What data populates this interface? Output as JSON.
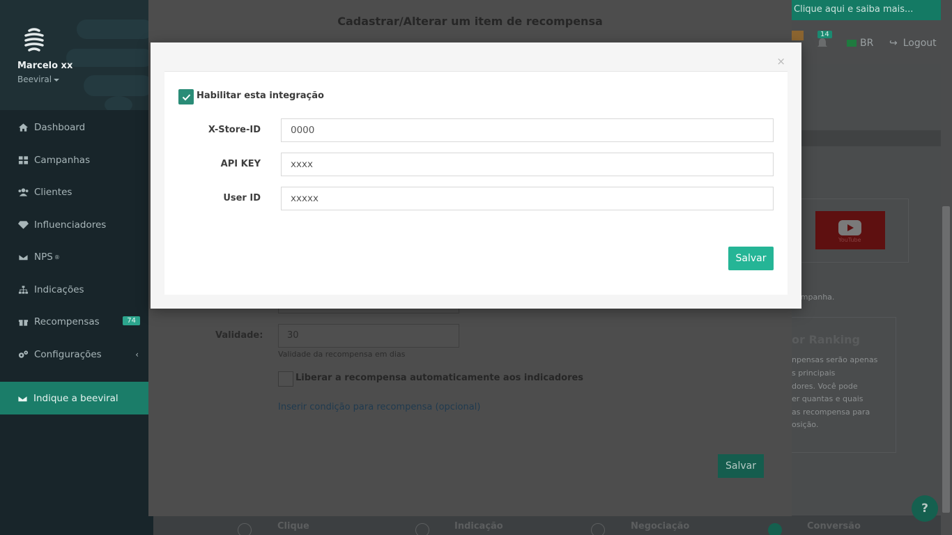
{
  "sidebar": {
    "user_name": "Marcelo xx",
    "org_name": "Beeviral",
    "items": [
      {
        "label": "Dashboard",
        "icon": "home-icon"
      },
      {
        "label": "Campanhas",
        "icon": "grid-icon"
      },
      {
        "label": "Clientes",
        "icon": "users-icon"
      },
      {
        "label": "Influenciadores",
        "icon": "diamond-icon"
      },
      {
        "label": "NPS",
        "icon": "envelope-icon",
        "sup": "®"
      },
      {
        "label": "Indicações",
        "icon": "sitemap-icon"
      },
      {
        "label": "Recompensas",
        "icon": "gift-icon",
        "badge": "74"
      },
      {
        "label": "Configurações",
        "icon": "gears-icon",
        "chevron": "‹"
      }
    ],
    "cta_label": "Indique a beeviral"
  },
  "topbar": {
    "banner_text": "Clique aqui e saiba mais...",
    "notifications_count": "14",
    "language": "BR",
    "logout_label": "Logout"
  },
  "background": {
    "youtube_label": "YouTube",
    "campaign_text": "campanha.",
    "ranking_title": "or Ranking",
    "ranking_lines": [
      "npensas serão apenas",
      "s principais",
      "dores. Você pode",
      "er quantas e quais",
      "as recompensa para",
      "osição."
    ],
    "bottom_tabs": [
      "Clique",
      "Indicação",
      "Negociação",
      "Conversão"
    ],
    "help_label": "?"
  },
  "modal_reward": {
    "title": "Cadastrar/Alterar um item de recompensa",
    "validity_label": "Validade:",
    "validity_value": "30",
    "validity_hint": "Validade da recompensa em dias",
    "auto_release_label": "Liberar a recompensa automaticamente aos indicadores",
    "condition_link": "Inserir condição para recompensa (opcional)",
    "save_label": "Salvar"
  },
  "modal_integration": {
    "close_label": "×",
    "enable_label": "Habilitar esta integração",
    "enabled": true,
    "fields": [
      {
        "label": "X-Store-ID",
        "value": "0000"
      },
      {
        "label": "API KEY",
        "value": "xxxx"
      },
      {
        "label": "User ID",
        "value": "xxxxx"
      }
    ],
    "save_label": "Salvar"
  },
  "colors": {
    "accent": "#25b596",
    "sidebar_bg": "#18252a",
    "cta_bg": "#1b7d69"
  }
}
